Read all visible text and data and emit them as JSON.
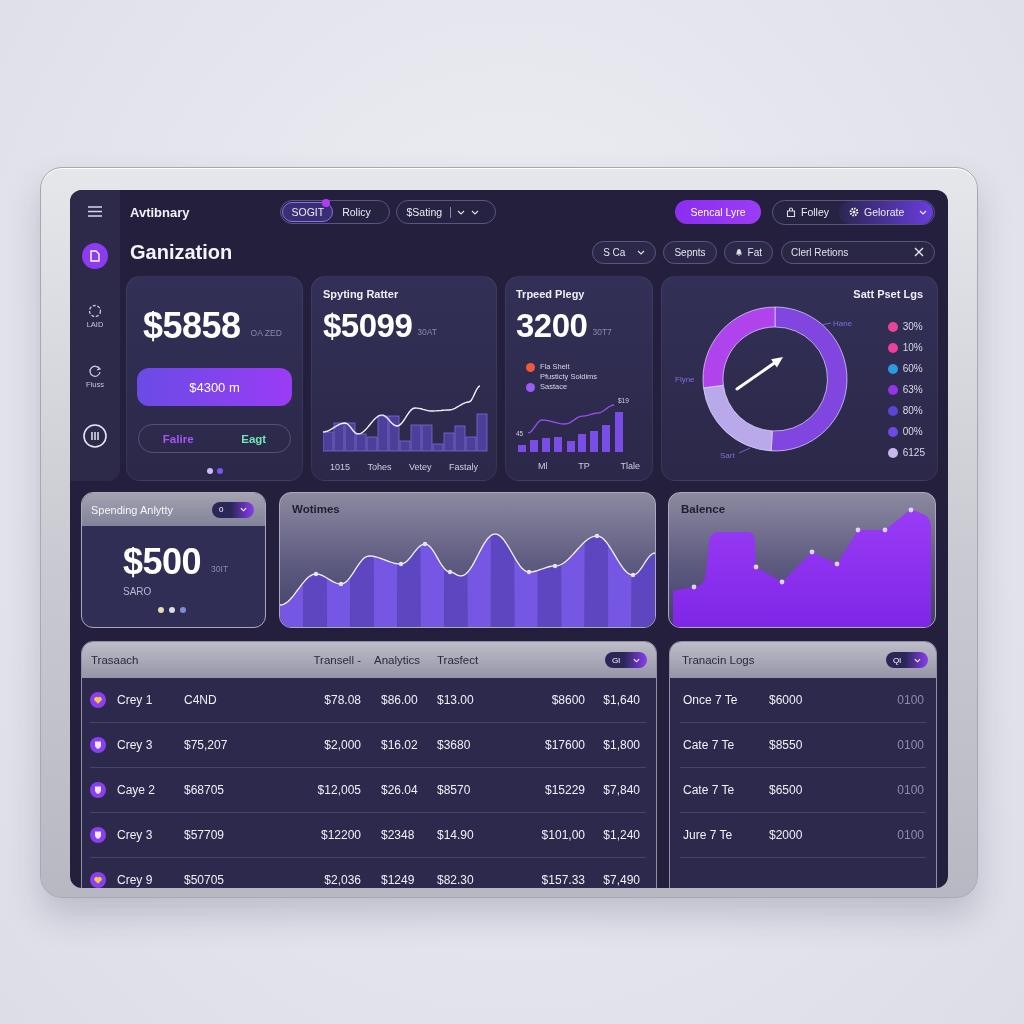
{
  "sidebar": {
    "items": [
      {
        "selected": true
      },
      {
        "label": "LAID",
        "selected": false
      },
      {
        "label": "Fluss",
        "selected": false
      },
      {
        "selected": false
      }
    ]
  },
  "header": {
    "subtitle": "Avtibnary",
    "title": "Ganization",
    "segments": [
      {
        "label": "SOGIT",
        "selected": true,
        "notified": true
      },
      {
        "label": "Rolicy",
        "selected": false,
        "notified": false
      }
    ],
    "dropdown": {
      "label": "$Sating"
    },
    "primary_button": "Sencal Lyre",
    "account": [
      {
        "label": "Folley",
        "selected": false
      },
      {
        "label": "Gelorate",
        "selected": true
      }
    ],
    "filters": [
      {
        "label": "S Ca",
        "kind": "dropdown"
      },
      {
        "label": "Sepnts",
        "kind": "plain"
      },
      {
        "label": "Fat",
        "kind": "icon"
      }
    ],
    "search": {
      "value": "Clerl Retions"
    }
  },
  "balance_card": {
    "amount": "$5858",
    "note": "OA ZED",
    "button": "$4300 m",
    "options": [
      {
        "label": "Falire",
        "color": "#a855f7"
      },
      {
        "label": "Eagt",
        "color": "#6ee7b7"
      }
    ],
    "pager": [
      {
        "selected": true
      },
      {
        "selected": false
      }
    ]
  },
  "spending_card": {
    "title": "Spyting Ratter",
    "amount": "$5099",
    "note": "30AT",
    "x_labels": [
      "1015",
      "Tohes",
      "Vetey",
      "Fastaly"
    ]
  },
  "typed_card": {
    "title": "Trpeed Plegy",
    "amount": "3200",
    "note": "30T7",
    "legend": [
      {
        "label": "Fla Shelt",
        "detail": "Pfusticty Soldims",
        "color": "#f05a3c"
      },
      {
        "label": "Sastace",
        "color": "#9b5cf6"
      }
    ],
    "point_labels": [
      "45",
      "$19"
    ],
    "x_labels": [
      "Ml",
      "TP",
      "Tlale"
    ]
  },
  "share_card": {
    "title": "Satt Pset Lgs",
    "slice_labels": [
      "Hane",
      "Flyne",
      "Sart"
    ],
    "legend": [
      {
        "value": "30%",
        "color": "#e8449a"
      },
      {
        "value": "10%",
        "color": "#ec3fa0"
      },
      {
        "value": "60%",
        "color": "#2b9be0"
      },
      {
        "value": "63%",
        "color": "#9333ea"
      },
      {
        "value": "80%",
        "color": "#5b45d6"
      },
      {
        "value": "00%",
        "color": "#6d4ae6"
      },
      {
        "value": "6125",
        "color": "#c9b8f0"
      }
    ]
  },
  "analytics_card": {
    "title": "Spending Anlytty",
    "selector": "0",
    "amount": "$500",
    "note": "30IT",
    "caption": "SARO",
    "dots": [
      {
        "color": "#e8dcae"
      },
      {
        "color": "#dcdcea"
      },
      {
        "color": "#7b8fd6"
      }
    ]
  },
  "volumes_card": {
    "title": "Wotimes"
  },
  "balance_chart": {
    "title": "Balence"
  },
  "transactions": {
    "columns": [
      "Trasaach",
      "",
      "Transell -",
      "Analytics",
      "Trasfect"
    ],
    "selector": "Gl",
    "rows": [
      [
        "Crey 1",
        "C4ND",
        "$78.08",
        "$86.00",
        "$13.00",
        "$8600",
        "$1,640"
      ],
      [
        "Crey 3",
        "$75,207",
        "$2,000",
        "$16.02",
        "$3680",
        "$17600",
        "$1,800"
      ],
      [
        "Caye 2",
        "$68705",
        "$12,005",
        "$26.04",
        "$8570",
        "$15229",
        "$7,840"
      ],
      [
        "Crey 3",
        "$57709",
        "$12200",
        "$2348",
        "$14.90",
        "$101,00",
        "$1,240"
      ],
      [
        "Crey 9",
        "$50705",
        "$2,036",
        "$1249",
        "$82.30",
        "$157.33",
        "$7,490"
      ]
    ]
  },
  "logs": {
    "title": "Tranacin Logs",
    "selector": "Ql",
    "rows": [
      [
        "Once 7 Te",
        "$6000",
        "0100"
      ],
      [
        "Cate 7 Te",
        "$8550",
        "0100"
      ],
      [
        "Cate 7 Te",
        "$6500",
        "0100"
      ],
      [
        "Jure 7 Te",
        "$2000",
        "0100"
      ]
    ]
  }
}
